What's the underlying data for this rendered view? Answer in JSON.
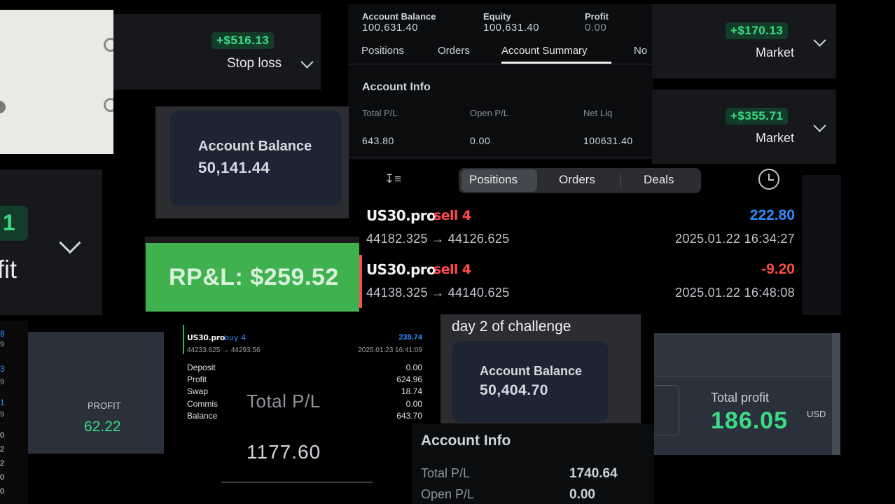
{
  "stoploss_card": {
    "amount": "+$516.13",
    "label": "Stop loss"
  },
  "market_card_1": {
    "amount": "+$170.13",
    "label": "Market"
  },
  "market_card_2": {
    "amount": "+$355.71",
    "label": "Market"
  },
  "profit_fragment": {
    "badge": "1",
    "label": "fit"
  },
  "account_summary": {
    "balance_label": "Account Balance",
    "balance_value": "100,631.40",
    "equity_label": "Equity",
    "equity_value": "100,631.40",
    "profit_label": "Profit",
    "profit_value": "0.00",
    "tabs": [
      "Positions",
      "Orders",
      "Account Summary",
      "No"
    ],
    "section_title": "Account Info",
    "total_pl_label": "Total P/L",
    "total_pl_value": "643.80",
    "open_pl_label": "Open P/L",
    "open_pl_value": "0.00",
    "net_liq_label": "Net Liq",
    "net_liq_value": "100631.40"
  },
  "balance_card_1": {
    "label": "Account Balance",
    "value": "50,141.44"
  },
  "rpl_banner": {
    "text": "RP&L: $259.52"
  },
  "mt5_positions": {
    "sort_glyph": "↧≡",
    "tabs": [
      "Positions",
      "Orders",
      "Deals"
    ],
    "trades": [
      {
        "symbol": "US30.pro",
        "side": "sell 4",
        "prices": "44182.325 → 44126.625",
        "profit": "222.80",
        "time": "2025.01.22 16:34:27"
      },
      {
        "symbol": "US30.pro",
        "side": "sell 4",
        "prices": "44138.325 → 44140.625",
        "profit": "-9.20",
        "time": "2025.01.22 16:48:08"
      }
    ]
  },
  "left_strip": {
    "digits": [
      "8",
      "9",
      "3",
      "9",
      "1",
      "9",
      "0",
      "2",
      "2",
      "0",
      "0"
    ]
  },
  "profit_small": {
    "label": "PROFIT",
    "value": "62.22"
  },
  "mt5_small": {
    "symbol": "US30.pro",
    "side": "buy 4",
    "profit": "239.74",
    "prices": "44233.625 → 44293.56",
    "time": "2025.01.23 16:41:09",
    "rows": [
      {
        "label": "Deposit",
        "value": "0.00"
      },
      {
        "label": "Profit",
        "value": "624.96"
      },
      {
        "label": "Swap",
        "value": "18.74"
      },
      {
        "label": "Commis",
        "value": "0.00"
      },
      {
        "label": "Balance",
        "value": "643.70"
      }
    ],
    "total_pl_label": "Total P/L",
    "total_pl_value": "1177.60"
  },
  "challenge_card": {
    "caption": "day 2 of challenge",
    "label": "Account Balance",
    "value": "50,404.70"
  },
  "account_info_2": {
    "title": "Account Info",
    "total_pl_label": "Total P/L",
    "total_pl_value": "1740.64",
    "open_pl_label": "Open P/L",
    "open_pl_value": "0.00"
  },
  "total_profit_card": {
    "label": "Total profit",
    "value": "186.05",
    "currency": "USD"
  },
  "colors": {
    "green": "#3ddc84",
    "rpl_green": "#3fb24f",
    "blue": "#2f8cff",
    "red": "#ff4a4a",
    "card_navy": "#1d2433"
  }
}
